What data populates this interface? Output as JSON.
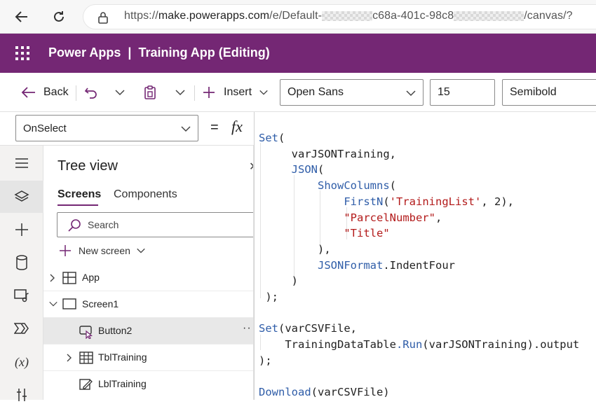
{
  "browser": {
    "url_prefix": "https://",
    "url_host": "make.powerapps.com",
    "url_part1": "/e/Default-",
    "url_part2": "c68a-401c-98c8",
    "url_part3": "/canvas/?"
  },
  "app": {
    "product": "Power Apps",
    "separator": "|",
    "title": "Training App (Editing)",
    "accent_color": "#742774"
  },
  "toolbar": {
    "back_label": "Back",
    "insert_label": "Insert",
    "font_family": "Open Sans",
    "font_size": "15",
    "font_weight": "Semibold"
  },
  "formula_bar": {
    "property": "OnSelect",
    "equals": "=",
    "fx": "fx"
  },
  "tree_view": {
    "title": "Tree view",
    "tabs": [
      "Screens",
      "Components"
    ],
    "search_placeholder": "Search",
    "new_screen_label": "New screen",
    "items": [
      {
        "label": "App",
        "icon": "app-icon"
      },
      {
        "label": "Screen1",
        "icon": "screen-icon"
      },
      {
        "label": "Button2",
        "icon": "button-icon",
        "selected": true
      },
      {
        "label": "TblTraining",
        "icon": "table-icon"
      },
      {
        "label": "LblTraining",
        "icon": "label-icon"
      }
    ],
    "more": "··"
  },
  "rail_icons": [
    "hamburger-icon",
    "layers-icon",
    "plus-icon",
    "database-icon",
    "media-icon",
    "power-automate-icon",
    "variables-icon",
    "tools-icon"
  ],
  "code": {
    "l1_fn": "Set",
    "l1_p": "(",
    "l2": "varJSONTraining,",
    "l3_fn": "JSON",
    "l3_p": "(",
    "l4_fn": "ShowColumns",
    "l4_p": "(",
    "l5_fn": "FirstN",
    "l5_a": "(",
    "l5_str": "'TrainingList'",
    "l5_b": ", 2),",
    "l6_str": "\"ParcelNumber\"",
    "l6_c": ",",
    "l7_str": "\"Title\"",
    "l8": "),",
    "l9_fn": "JSONFormat",
    "l9_rest": ".IndentFour",
    "l10": ")",
    "l11": ");",
    "l13_fn": "Set",
    "l13_rest": "(varCSVFile,",
    "l14_a": "TrainingDataTable",
    "l14_fn": ".Run",
    "l14_b": "(varJSONTraining).output",
    "l15": ");",
    "l17_fn": "Download",
    "l17_rest": "(varCSVFile)"
  }
}
